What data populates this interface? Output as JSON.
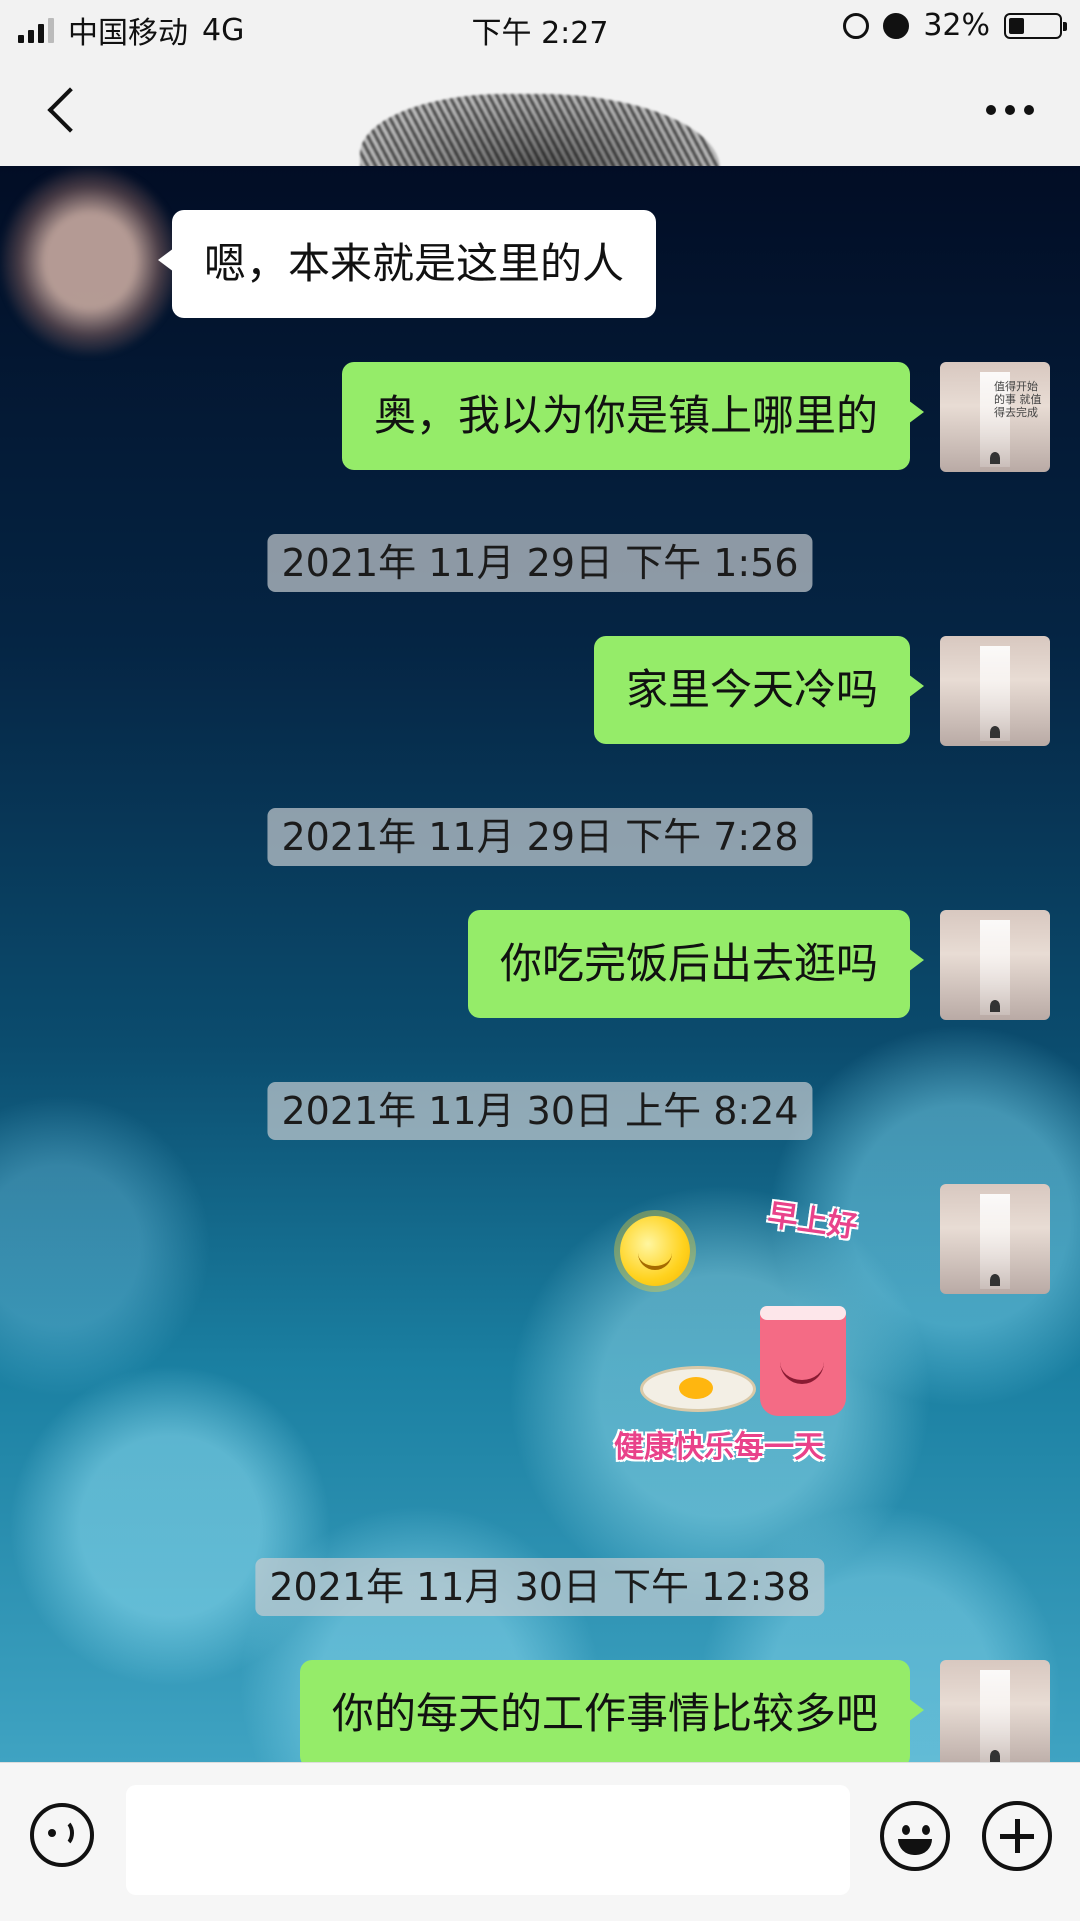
{
  "status_bar": {
    "carrier": "中国移动",
    "network": "4G",
    "time": "下午 2:27",
    "battery": "32%",
    "battery_level": 0.32
  },
  "nav": {
    "back_icon": "chevron-left-icon",
    "more_icon": "more-dots-icon"
  },
  "messages": [
    {
      "type": "in",
      "text": "嗯，本来就是这里的人"
    },
    {
      "type": "out",
      "text": "奥，我以为你是镇上哪里的"
    },
    {
      "type": "time",
      "text": "2021年 11月 29日 下午 1:56"
    },
    {
      "type": "out",
      "text": "家里今天冷吗"
    },
    {
      "type": "time",
      "text": "2021年 11月 29日 下午 7:28"
    },
    {
      "type": "out",
      "text": "你吃完饭后出去逛吗"
    },
    {
      "type": "time",
      "text": "2021年 11月 30日 上午 8:24"
    },
    {
      "type": "sticker",
      "top_text": "早上好",
      "bottom_text": "健康快乐每一天"
    },
    {
      "type": "time",
      "text": "2021年 11月 30日 下午 12:38"
    },
    {
      "type": "out",
      "text": "你的每天的工作事情比较多吧"
    }
  ],
  "self_avatar_caption": "值得开始的事 就值得去完成",
  "input_bar": {
    "voice_icon": "voice-icon",
    "message_value": "",
    "emoji_icon": "emoji-icon",
    "plus_icon": "plus-icon"
  },
  "colors": {
    "outgoing_bubble": "#95ec69",
    "incoming_bubble": "#ffffff"
  }
}
